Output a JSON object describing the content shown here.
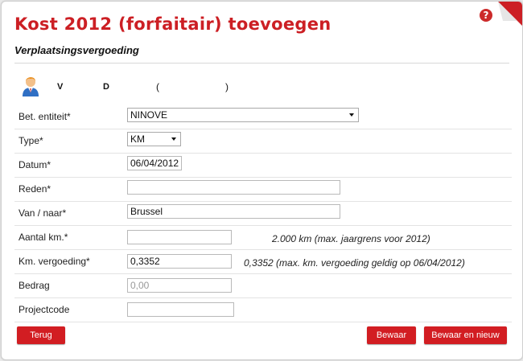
{
  "dialog": {
    "title": "Kost 2012 (forfaitair) toevoegen",
    "help_glyph": "?",
    "section_title": "Verplaatsingsvergoeding"
  },
  "user_info": {
    "icon": "user-avatar-icon",
    "v": "V",
    "d": "D",
    "paren_open": "(",
    "paren_close": ")"
  },
  "form": {
    "bet_entiteit": {
      "label": "Bet. entiteit*",
      "value": "NINOVE"
    },
    "type": {
      "label": "Type*",
      "value": "KM"
    },
    "datum": {
      "label": "Datum*",
      "value": "06/04/2012"
    },
    "reden": {
      "label": "Reden*",
      "value": ""
    },
    "van_naar": {
      "label": "Van / naar*",
      "value": "Brussel"
    },
    "aantal_km": {
      "label": "Aantal km.*",
      "value": "",
      "hint": "2.000 km (max. jaargrens voor 2012)"
    },
    "km_vergoeding": {
      "label": "Km. vergoeding*",
      "value": "0,3352",
      "hint": "0,3352 (max. km. vergoeding geldig op 06/04/2012)"
    },
    "bedrag": {
      "label": "Bedrag",
      "value": "0,00"
    },
    "projectcode": {
      "label": "Projectcode",
      "value": ""
    }
  },
  "buttons": {
    "terug": "Terug",
    "bewaar": "Bewaar",
    "bewaar_nieuw": "Bewaar en nieuw"
  },
  "colors": {
    "accent": "#cc1f24",
    "button": "#d21d22"
  }
}
